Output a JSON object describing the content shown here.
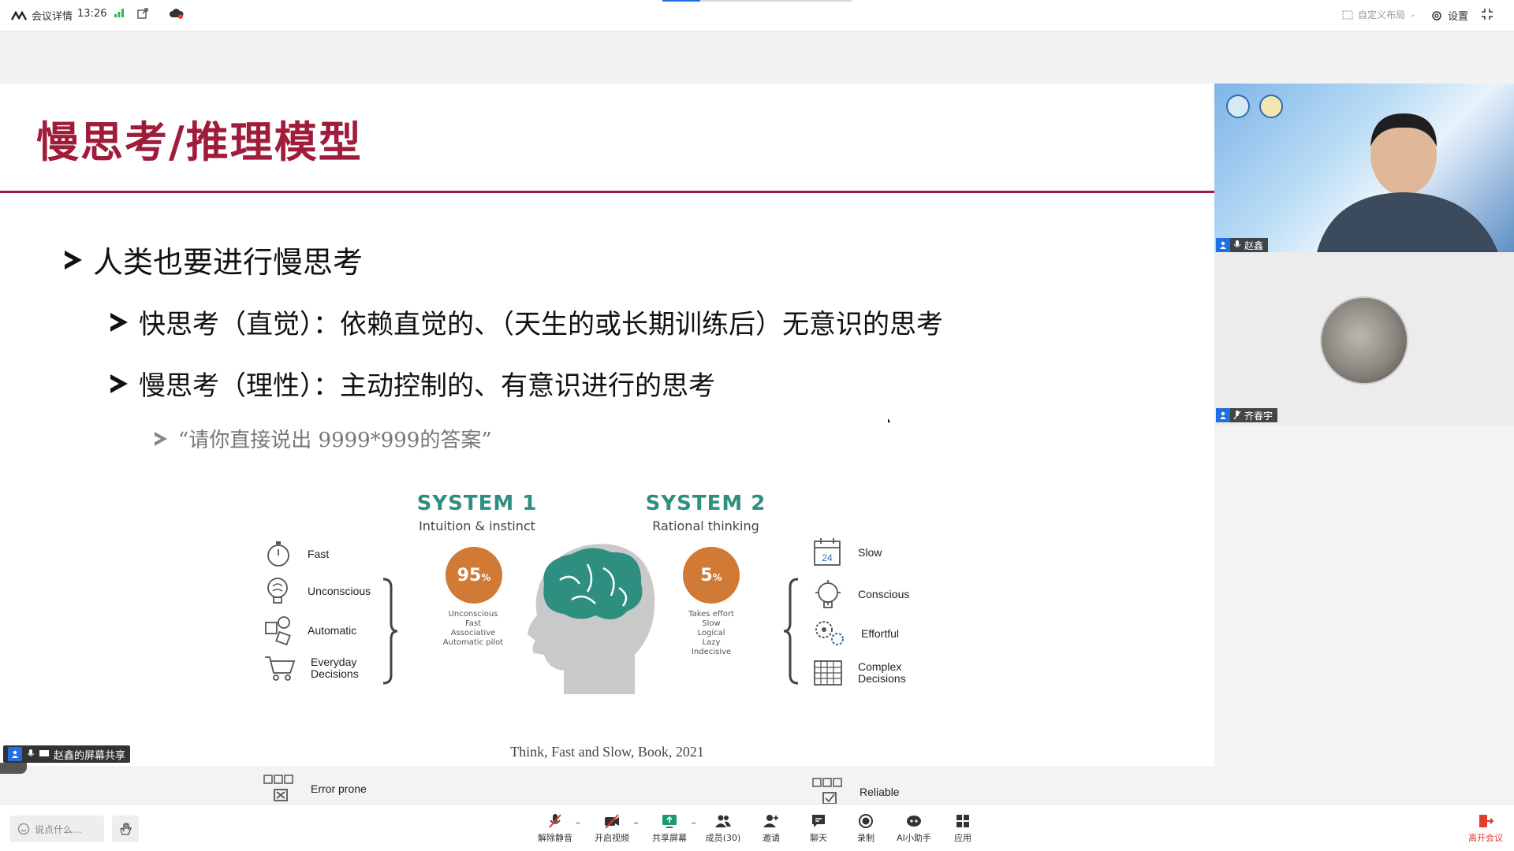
{
  "topbar": {
    "meeting_info": "会议详情",
    "time": "13:26",
    "custom_layout": "自定义布局",
    "settings": "设置"
  },
  "slide": {
    "title": "慢思考/推理模型",
    "bullet1": "人类也要进行慢思考",
    "bullet2": "快思考（直觉）：依赖直觉的、（天生的或长期训练后）无意识的思考",
    "bullet3": "慢思考（理性）：主动控制的、有意识进行的思考",
    "bullet4": "“请你直接说出 9999*999的答案”",
    "citation": "Think, Fast and Slow, Book, 2021"
  },
  "figure": {
    "system1": {
      "title": "SYSTEM 1",
      "subtitle": "Intuition & instinct",
      "percent": "95",
      "percent_sign": "%",
      "desc": [
        "Unconscious",
        "Fast",
        "Associative",
        "Automatic pilot"
      ],
      "features": [
        "Fast",
        "Unconscious",
        "Automatic",
        "Everyday Decisions",
        "Error prone"
      ]
    },
    "system2": {
      "title": "SYSTEM 2",
      "subtitle": "Rational thinking",
      "percent": "5",
      "percent_sign": "%",
      "desc": [
        "Takes effort",
        "Slow",
        "Logical",
        "Lazy",
        "Indecisive"
      ],
      "features": [
        "Slow",
        "Conscious",
        "Effortful",
        "Complex Decisions",
        "Reliable"
      ]
    },
    "calendar_day": "24",
    "brain_color": "#2e8f80",
    "percent_color": "#d07a35"
  },
  "share_label": "赵鑫的屏幕共享",
  "participants": [
    {
      "name": "赵鑫"
    },
    {
      "name": "齐春宇"
    }
  ],
  "bottombar": {
    "chat_placeholder": "说点什么...",
    "controls": [
      "解除静音",
      "开启视频",
      "共享屏幕",
      "成员(30)",
      "邀请",
      "聊天",
      "录制",
      "AI小助手",
      "应用"
    ],
    "leave": "离开会议"
  }
}
